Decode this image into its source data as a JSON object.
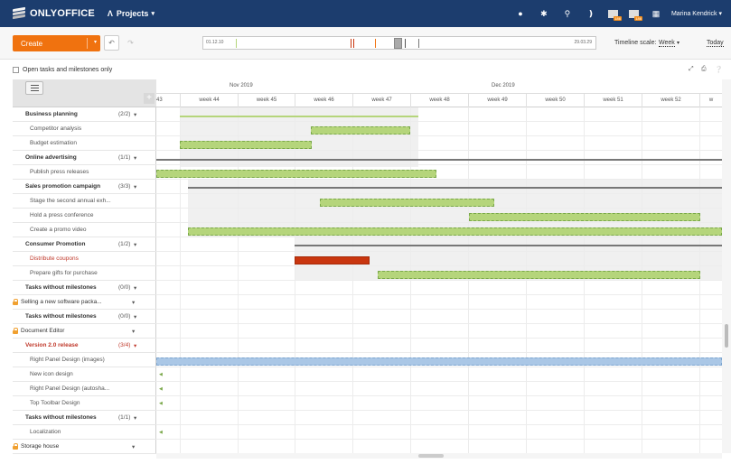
{
  "header": {
    "logo_text": "ONLYOFFICE",
    "module": "Projects",
    "user": "Marina Kendrick",
    "badges": [
      "186",
      "186"
    ]
  },
  "toolbar": {
    "create_label": "Create",
    "timeline_start": "01.12.10",
    "timeline_end": "29.03.29",
    "timeline_scale_label": "Timeline scale:",
    "timeline_scale_value": "Week",
    "today_label": "Today"
  },
  "filter": {
    "open_only_label": "Open tasks and milestones only"
  },
  "gantt": {
    "months": [
      "Nov 2019",
      "Dec 2019"
    ],
    "weeks": [
      "43",
      "week 44",
      "week 45",
      "week 46",
      "week 47",
      "week 48",
      "week 49",
      "week 50",
      "week 51",
      "week 52",
      "w"
    ]
  },
  "rows": [
    {
      "type": "ms",
      "name": "Business planning",
      "count": "(2/2)"
    },
    {
      "type": "task",
      "name": "Competitor analysis"
    },
    {
      "type": "task",
      "name": "Budget estimation"
    },
    {
      "type": "ms",
      "name": "Online advertising",
      "count": "(1/1)"
    },
    {
      "type": "task",
      "name": "Publish press releases"
    },
    {
      "type": "ms",
      "name": "Sales promotion campaign",
      "count": "(3/3)"
    },
    {
      "type": "task",
      "name": "Stage the second annual exh..."
    },
    {
      "type": "task",
      "name": "Hold a press conference"
    },
    {
      "type": "task",
      "name": "Create a promo video"
    },
    {
      "type": "ms",
      "name": "Consumer Promotion",
      "count": "(1/2)"
    },
    {
      "type": "task-red",
      "name": "Distribute coupons"
    },
    {
      "type": "task",
      "name": "Prepare gifts for purchase"
    },
    {
      "type": "ms",
      "name": "Tasks without milestones",
      "count": "(0/0)"
    },
    {
      "type": "proj",
      "name": "Selling a new software packa..."
    },
    {
      "type": "ms",
      "name": "Tasks without milestones",
      "count": "(0/0)"
    },
    {
      "type": "proj",
      "name": "Document Editor"
    },
    {
      "type": "ms-red",
      "name": "Version 2.0 release",
      "count": "(3/4)"
    },
    {
      "type": "task",
      "name": "Right Panel Design (images)"
    },
    {
      "type": "task",
      "name": "New icon design"
    },
    {
      "type": "task",
      "name": "Right Panel Design (autosha..."
    },
    {
      "type": "task",
      "name": "Top Toolbar Design"
    },
    {
      "type": "ms",
      "name": "Tasks without milestones",
      "count": "(1/1)"
    },
    {
      "type": "task",
      "name": "Localization"
    },
    {
      "type": "proj",
      "name": "Storage house"
    }
  ]
}
